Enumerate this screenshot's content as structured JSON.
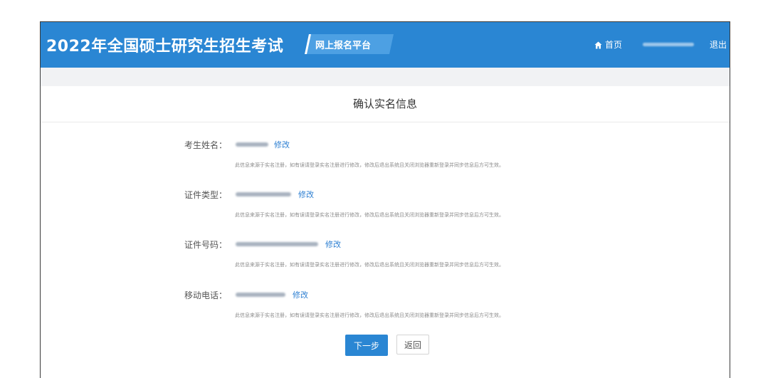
{
  "header": {
    "title": "2022年全国硕士研究生招生考试",
    "platform_badge": "网上报名平台",
    "home_label": "首页",
    "logout_label": "退出"
  },
  "page": {
    "title": "确认实名信息"
  },
  "fields": [
    {
      "label": "考生姓名：",
      "edit_label": "修改",
      "note": "此信息来源于实名注册，如有误请登录实名注册进行修改，修改后退出系统且关闭浏览器重新登录并同步信息后方可生效。"
    },
    {
      "label": "证件类型：",
      "edit_label": "修改",
      "note": "此信息来源于实名注册，如有误请登录实名注册进行修改，修改后退出系统且关闭浏览器重新登录并同步信息后方可生效。"
    },
    {
      "label": "证件号码：",
      "edit_label": "修改",
      "note": "此信息来源于实名注册，如有误请登录实名注册进行修改，修改后退出系统且关闭浏览器重新登录并同步信息后方可生效。"
    },
    {
      "label": "移动电话：",
      "edit_label": "修改",
      "note": "此信息来源于实名注册，如有误请登录实名注册进行修改，修改后退出系统且关闭浏览器重新登录并同步信息后方可生效。"
    }
  ],
  "buttons": {
    "next": "下一步",
    "back": "返回"
  },
  "colors": {
    "header_bg": "#2a86d3",
    "link": "#2d7fd2",
    "primary_button": "#2a86d3"
  }
}
